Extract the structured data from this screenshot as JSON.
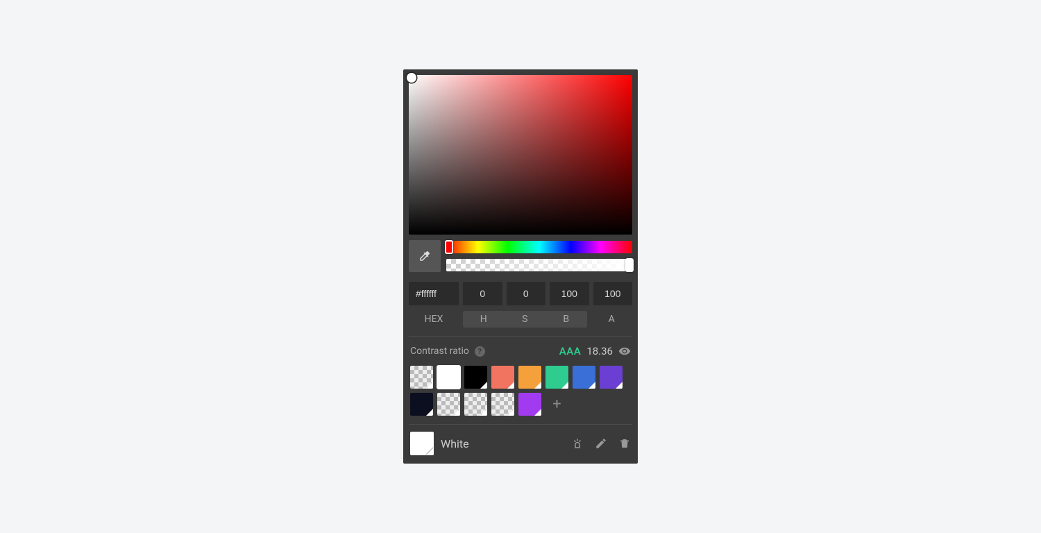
{
  "inputs": {
    "hex": "#ffffff",
    "h": "0",
    "s": "0",
    "b": "100",
    "a": "100"
  },
  "labels": {
    "hex": "HEX",
    "h": "H",
    "s": "S",
    "b": "B",
    "a": "A"
  },
  "contrast": {
    "label": "Contrast ratio",
    "rating": "AAA",
    "value": "18.36"
  },
  "swatches_row1": [
    {
      "checker": true,
      "corner": true
    },
    {
      "color": "#ffffff",
      "corner": true,
      "selected": true
    },
    {
      "color": "#000000",
      "corner": true
    },
    {
      "color": "#f17461",
      "corner": true
    },
    {
      "color": "#f5a13b",
      "corner": true
    },
    {
      "color": "#2ecc8f",
      "corner": true
    },
    {
      "color": "#3a6fd8",
      "corner": true
    },
    {
      "color": "#6b3fd4",
      "corner": true
    }
  ],
  "swatches_row2": [
    {
      "color": "#0c0f1f",
      "corner": true
    },
    {
      "checker": true,
      "corner": true
    },
    {
      "checker": true,
      "corner": true
    },
    {
      "checker": true,
      "corner": true
    },
    {
      "color": "#a23bf0",
      "corner": true
    }
  ],
  "footer": {
    "current_color": "#ffffff",
    "name": "White"
  }
}
